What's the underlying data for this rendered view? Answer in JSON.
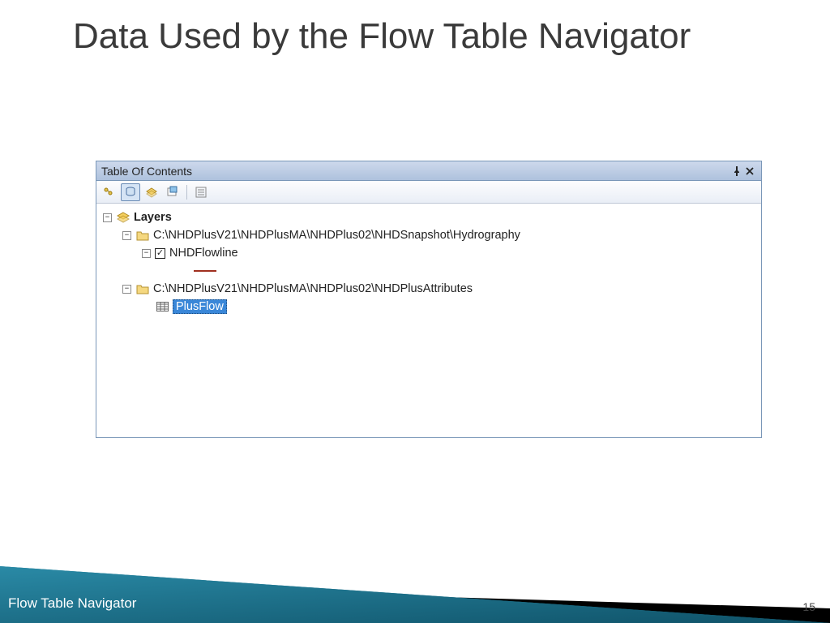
{
  "slide": {
    "title": "Data Used by the Flow Table Navigator",
    "footer_caption": "Flow Table Navigator",
    "number": "15"
  },
  "toc": {
    "title": "Table Of Contents",
    "root_label": "Layers",
    "folder1_path": "C:\\NHDPlusV21\\NHDPlusMA\\NHDPlus02\\NHDSnapshot\\Hydrography",
    "layer1_name": "NHDFlowline",
    "folder2_path": "C:\\NHDPlusV21\\NHDPlusMA\\NHDPlus02\\NHDPlusAttributes",
    "table1_name": "PlusFlow"
  }
}
